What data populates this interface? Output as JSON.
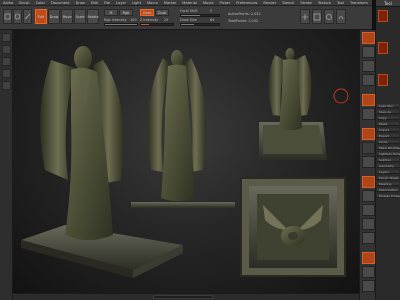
{
  "app": {
    "menu": [
      "Alpha",
      "Brush",
      "Color",
      "Document",
      "Draw",
      "Edit",
      "File",
      "Layer",
      "Light",
      "Macro",
      "Marker",
      "Material",
      "Movie",
      "Picker",
      "Preferences",
      "Render",
      "Stencil",
      "Stroke",
      "Texture",
      "Tool",
      "Transform",
      "Zplugin",
      "Zscript"
    ]
  },
  "toolbar": {
    "buttons": [
      "Edit",
      "Draw",
      "Move",
      "Scale",
      "Rotate"
    ],
    "active_button": "Edit",
    "zadd_label": "Zadd",
    "zsub_label": "Zsub",
    "rgb_label": "Rgb",
    "m_label": "M",
    "focal_label": "Focal Shift",
    "focal_value": "0",
    "drawsize_label": "Draw Size",
    "drawsize_value": "64",
    "z_intensity_label": "Z Intensity",
    "z_intensity_value": "25",
    "rgb_intensity_label": "Rgb Intensity",
    "rgb_intensity_value": "100",
    "active_points": "ActivePoints: 2,032",
    "total_points": "TotalPoints: 2,032",
    "sliders": {
      "focal": 0.5,
      "drawsize": 0.35,
      "z_intensity": 0.25,
      "rgb_intensity": 1.0
    }
  },
  "right_panel": {
    "title": "Tool",
    "rows": [
      "Load Tool",
      "Save As",
      "Copy",
      "Paste",
      "Import",
      "Export",
      "Clone",
      "Make PolyMesh3D",
      "Lightbox Tools",
      "SubTool",
      "Geometry",
      "Layers",
      "Morph Target",
      "Masking",
      "Deformation",
      "Display Properties"
    ]
  },
  "viewport": {
    "objects": [
      "angel-statue-perspective",
      "angel-statue-front",
      "angel-statue-small",
      "angel-statue-top-view"
    ]
  },
  "colors": {
    "accent": "#d2592a",
    "panel": "#3a3a3a",
    "viewport_center": "#3a3a3a"
  }
}
